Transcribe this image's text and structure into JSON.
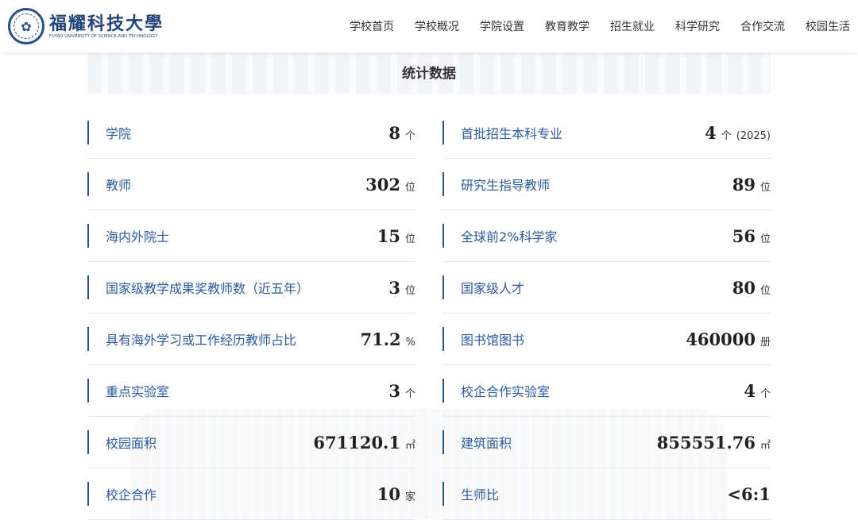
{
  "header": {
    "logo_cn": "福耀科技大學",
    "logo_en": "FUYAO UNIVERSITY OF SCIENCE AND TECHNOLOGY",
    "nav": [
      "学校首页",
      "学校概况",
      "学院设置",
      "教育教学",
      "招生就业",
      "科学研究",
      "合作交流",
      "校园生活"
    ]
  },
  "title": "统计数据",
  "stats": [
    {
      "label": "学院",
      "value": "8",
      "unit": "个"
    },
    {
      "label": "首批招生本科专业",
      "value": "4",
      "unit": "个",
      "note": "(2025)"
    },
    {
      "label": "教师",
      "value": "302",
      "unit": "位"
    },
    {
      "label": "研究生指导教师",
      "value": "89",
      "unit": "位"
    },
    {
      "label": "海内外院士",
      "value": "15",
      "unit": "位"
    },
    {
      "label": "全球前2%科学家",
      "value": "56",
      "unit": "位"
    },
    {
      "label": "国家级教学成果奖教师数（近五年）",
      "value": "3",
      "unit": "位"
    },
    {
      "label": "国家级人才",
      "value": "80",
      "unit": "位"
    },
    {
      "label": "具有海外学习或工作经历教师占比",
      "value": "71.2",
      "unit": "%"
    },
    {
      "label": "图书馆图书",
      "value": "460000",
      "unit": "册"
    },
    {
      "label": "重点实验室",
      "value": "3",
      "unit": "个"
    },
    {
      "label": "校企合作实验室",
      "value": "4",
      "unit": "个"
    },
    {
      "label": "校园面积",
      "value": "671120.1",
      "unit": "㎡"
    },
    {
      "label": "建筑面积",
      "value": "855551.76",
      "unit": "㎡"
    },
    {
      "label": "校企合作",
      "value": "10",
      "unit": "家"
    },
    {
      "label": "生师比",
      "value": "<6:1",
      "unit": ""
    }
  ]
}
